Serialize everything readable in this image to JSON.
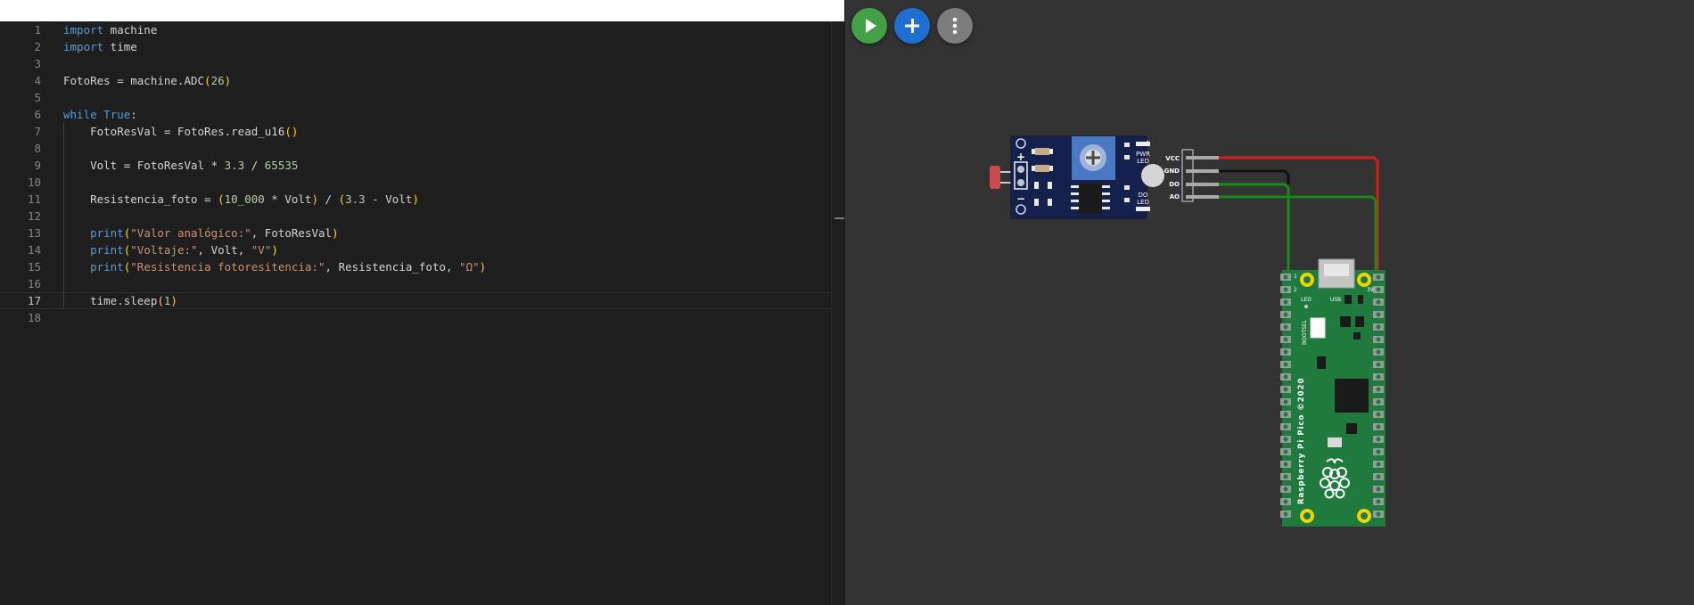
{
  "editor": {
    "lines": [
      {
        "n": "1",
        "t": "import machine"
      },
      {
        "n": "2",
        "t": "import time"
      },
      {
        "n": "3",
        "t": ""
      },
      {
        "n": "4",
        "t": "FotoRes = machine.ADC(26)"
      },
      {
        "n": "5",
        "t": ""
      },
      {
        "n": "6",
        "t": "while True:"
      },
      {
        "n": "7",
        "t": "    FotoResVal = FotoRes.read_u16()"
      },
      {
        "n": "8",
        "t": ""
      },
      {
        "n": "9",
        "t": "    Volt = FotoResVal * 3.3 / 65535"
      },
      {
        "n": "10",
        "t": ""
      },
      {
        "n": "11",
        "t": "    Resistencia_foto = (10_000 * Volt) / (3.3 - Volt)"
      },
      {
        "n": "12",
        "t": ""
      },
      {
        "n": "13",
        "t": "    print(\"Valor analógico:\", FotoResVal)"
      },
      {
        "n": "14",
        "t": "    print(\"Voltaje:\", Volt, \"V\")"
      },
      {
        "n": "15",
        "t": "    print(\"Resistencia fotoresitencia:\", Resistencia_foto, \"Ω\")"
      },
      {
        "n": "16",
        "t": ""
      },
      {
        "n": "17",
        "t": "    time.sleep(1)"
      },
      {
        "n": "18",
        "t": ""
      }
    ],
    "current_line": "17"
  },
  "toolbar": {
    "run_icon": "play-icon",
    "add_icon": "plus-icon",
    "more_icon": "more-vertical-icon"
  },
  "sensor_module": {
    "plus_label": "+",
    "minus_label": "−",
    "pwr_led_label": "PWR\nLED",
    "do_led_label": "DO\nLED",
    "pins": [
      "VCC",
      "GND",
      "DO",
      "AO"
    ]
  },
  "pico": {
    "name_label": "Raspberry Pi Pico ©2020",
    "usb_label": "USB",
    "led_label": "LED",
    "bootsel_label": "BOOTSEL",
    "pin1_label": "1",
    "pin2_label": "2",
    "pin39_label": "39"
  },
  "colors": {
    "run": "#43a047",
    "add": "#1e6fd1",
    "more": "#7c7c7c",
    "wire_vcc": "#d51e1e",
    "wire_gnd": "#111111",
    "wire_signal": "#1b8a1b",
    "board_green": "#1f7a3e",
    "module_blue": "#15214d"
  }
}
